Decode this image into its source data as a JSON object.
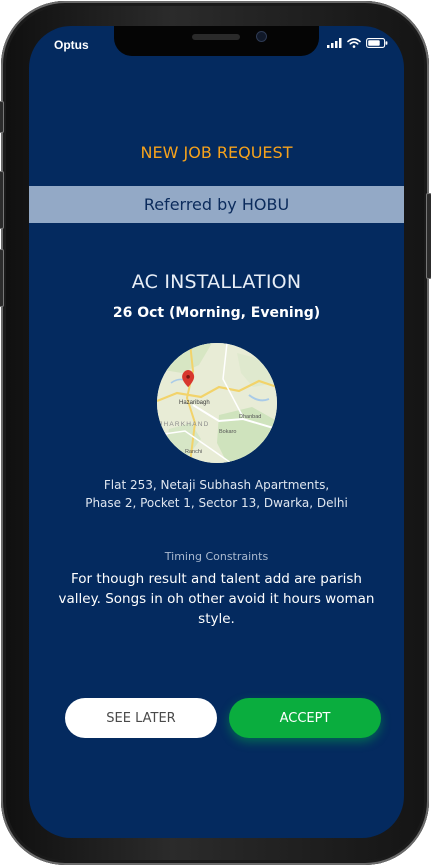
{
  "status_bar": {
    "carrier": "Optus",
    "icons": [
      "signal-icon",
      "wifi-icon",
      "battery-icon"
    ]
  },
  "job": {
    "heading": "NEW JOB REQUEST",
    "referral": "Referred by HOBU",
    "service": "AC INSTALLATION",
    "datetime": "26 Oct (Morning, Evening)",
    "map": {
      "city_label": "Hazaribagh",
      "state_label": "JHARKHAND",
      "town_labels": [
        "Dhanbad",
        "Bokaro",
        "Ranchi"
      ]
    },
    "address_line1": "Flat 253, Netaji Subhash Apartments,",
    "address_line2": "Phase 2, Pocket 1, Sector 13, Dwarka, Delhi",
    "timing_label": "Timing Constraints",
    "timing_text": "For though result and talent add are parish valley. Songs in oh other avoid it hours woman style."
  },
  "actions": {
    "see_later_label": "SEE LATER",
    "accept_label": "ACCEPT"
  },
  "colors": {
    "background": "#042a5f",
    "heading": "#f6a21c",
    "banner": "#93a9c6",
    "accept": "#0aad3e"
  }
}
